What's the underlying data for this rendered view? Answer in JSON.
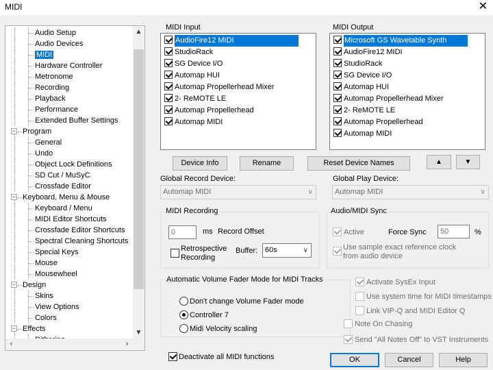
{
  "window": {
    "title": "MIDI",
    "close_glyph": "✕"
  },
  "tree": {
    "items": [
      {
        "label": "Audio Setup",
        "level": 2
      },
      {
        "label": "Audio Devices",
        "level": 2
      },
      {
        "label": "MIDI",
        "level": 2,
        "selected": true
      },
      {
        "label": "Hardware Controller",
        "level": 2
      },
      {
        "label": "Metronome",
        "level": 2
      },
      {
        "label": "Recording",
        "level": 2
      },
      {
        "label": "Playback",
        "level": 2
      },
      {
        "label": "Performance",
        "level": 2
      },
      {
        "label": "Extended Buffer Settings",
        "level": 2
      },
      {
        "label": "Program",
        "level": 1
      },
      {
        "label": "General",
        "level": 2
      },
      {
        "label": "Undo",
        "level": 2
      },
      {
        "label": "Object Lock Definitions",
        "level": 2
      },
      {
        "label": "SD Cut / MuSyC",
        "level": 2
      },
      {
        "label": "Crossfade Editor",
        "level": 2
      },
      {
        "label": "Keyboard, Menu & Mouse",
        "level": 1
      },
      {
        "label": "Keyboard / Menu",
        "level": 2
      },
      {
        "label": "MIDI Editor Shortcuts",
        "level": 2
      },
      {
        "label": "Crossfade Editor Shortcuts",
        "level": 2
      },
      {
        "label": "Spectral Cleaning Shortcuts",
        "level": 2
      },
      {
        "label": "Special Keys",
        "level": 2
      },
      {
        "label": "Mouse",
        "level": 2
      },
      {
        "label": "Mousewheel",
        "level": 2
      },
      {
        "label": "Design",
        "level": 1
      },
      {
        "label": "Skins",
        "level": 2
      },
      {
        "label": "View Options",
        "level": 2
      },
      {
        "label": "Colors",
        "level": 2
      },
      {
        "label": "Effects",
        "level": 1
      },
      {
        "label": "Dithering",
        "level": 2
      }
    ],
    "scroll_up": "▲",
    "scroll_down": "▼",
    "scroll_left": "‹",
    "scroll_right": "›"
  },
  "midi_input": {
    "label": "MIDI Input",
    "items": [
      "AudioFire12 MIDI",
      "StudioRack",
      "SG Device I/O",
      "Automap HUI",
      "Automap Propellerhead Mixer",
      "2- ReMOTE LE",
      "Automap Propellerhead",
      "Automap MIDI"
    ]
  },
  "midi_output": {
    "label": "MIDI Output",
    "items": [
      "Microsoft GS Wavetable Synth",
      "AudioFire12 MIDI",
      "StudioRack",
      "SG Device I/O",
      "Automap HUI",
      "Automap Propellerhead Mixer",
      "2- ReMOTE LE",
      "Automap Propellerhead",
      "Automap MIDI"
    ]
  },
  "buttons": {
    "device_info": "Device Info",
    "rename": "Rename",
    "reset_names": "Reset Device Names",
    "up": "▲",
    "down": "▼",
    "ok": "OK",
    "cancel": "Cancel",
    "help": "Help"
  },
  "global_record": {
    "label": "Global Record Device:",
    "value": "Automap MIDI"
  },
  "global_play": {
    "label": "Global Play Device:",
    "value": "Automap MIDI"
  },
  "midi_recording": {
    "title": "MIDI Recording",
    "offset_value": "0",
    "offset_unit": "ms",
    "offset_label": "Record Offset",
    "retro_line1": "Retrospective",
    "retro_line2": "Recording",
    "buffer_label": "Buffer:",
    "buffer_value": "60s"
  },
  "sync": {
    "title": "Audio/MIDI Sync",
    "active": "Active",
    "force_sync": "Force Sync",
    "force_value": "50",
    "percent": "%",
    "sample_line1": "Use sample exact reference clock",
    "sample_line2": "from audio device"
  },
  "fader": {
    "title": "Automatic Volume Fader Mode for MIDI Tracks",
    "options": [
      "Don't change Volume Fader mode",
      "Controller 7",
      "Midi Velocity scaling"
    ]
  },
  "options": {
    "sysex": "Activate SysEx Input",
    "system_time": "Use system time for MIDI timestamps",
    "link_vip": "Link VIP-Q and MIDI Editor Q",
    "note_chasing": "Note On Chasing",
    "all_notes_off": "Send \"All Notes Off\" to VST Instruments"
  },
  "deactivate": "Deactivate all MIDI functions"
}
